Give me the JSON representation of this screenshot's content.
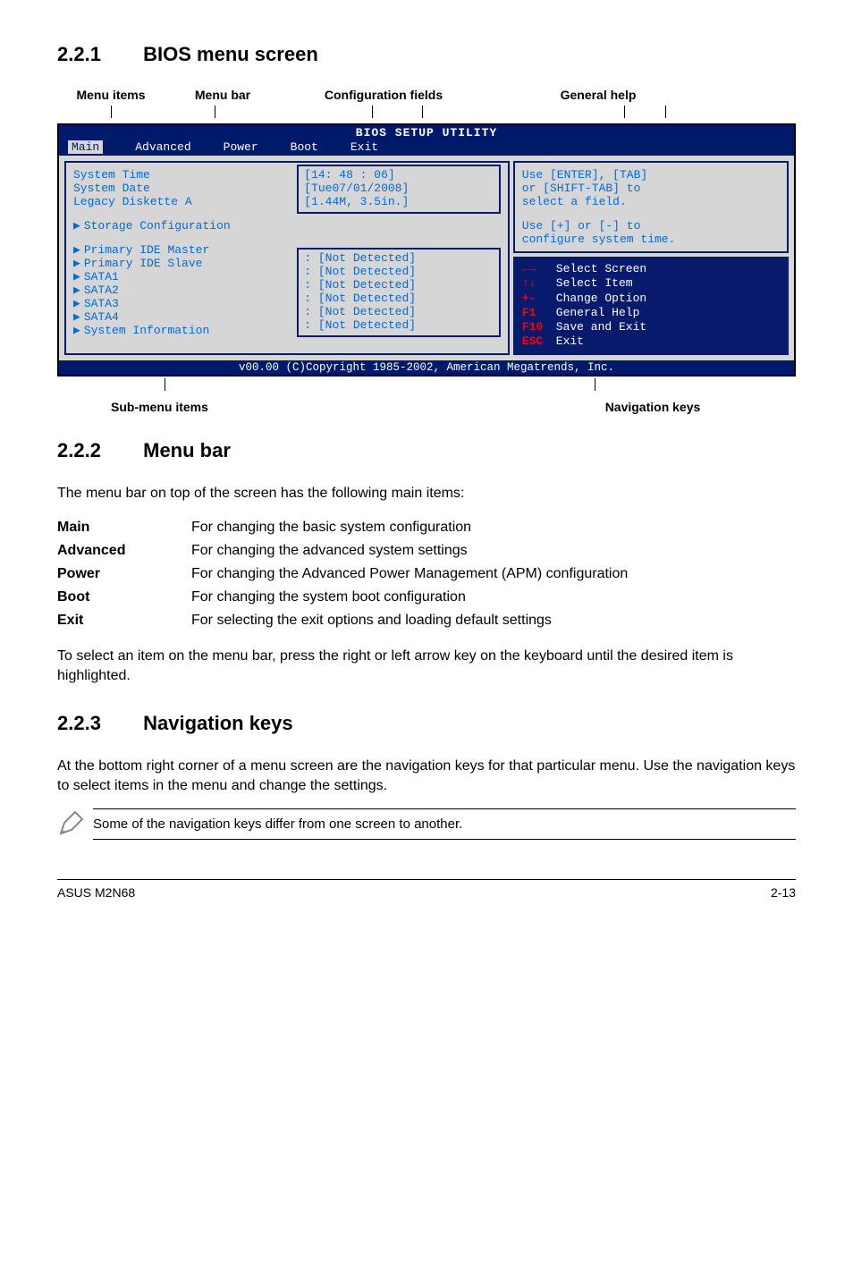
{
  "sections": {
    "s1": {
      "num": "2.2.1",
      "title": "BIOS menu screen"
    },
    "s2": {
      "num": "2.2.2",
      "title": "Menu bar"
    },
    "s3": {
      "num": "2.2.3",
      "title": "Navigation keys"
    }
  },
  "diagram_labels": {
    "menu_items": "Menu items",
    "menu_bar": "Menu bar",
    "config_fields": "Configuration fields",
    "general_help": "General help",
    "sub_menu": "Sub-menu items",
    "nav_keys": "Navigation keys"
  },
  "bios": {
    "title": "BIOS SETUP UTILITY",
    "tabs": {
      "main": "Main",
      "advanced": "Advanced",
      "power": "Power",
      "boot": "Boot",
      "exit": "Exit"
    },
    "fields": {
      "system_time": {
        "label": "System Time",
        "value": "[14: 48 : 06]"
      },
      "system_date": {
        "label": "System Date",
        "value": "[Tue07/01/2008]"
      },
      "legacy_diskette": {
        "label": "Legacy Diskette A",
        "value": "[1.44M, 3.5in.]"
      },
      "storage_config": {
        "label": "Storage Configuration"
      },
      "pri_master": {
        "label": "Primary IDE Master",
        "value": ": [Not Detected]"
      },
      "pri_slave": {
        "label": "Primary IDE Slave",
        "value": ": [Not Detected]"
      },
      "sata1": {
        "label": "SATA1",
        "value": ": [Not Detected]"
      },
      "sata2": {
        "label": "SATA2",
        "value": ": [Not Detected]"
      },
      "sata3": {
        "label": "SATA3",
        "value": ": [Not Detected]"
      },
      "sata4": {
        "label": "SATA4",
        "value": ": [Not Detected]"
      },
      "sys_info": {
        "label": "System Information"
      }
    },
    "help": {
      "l1": "Use [ENTER], [TAB]",
      "l2": "or [SHIFT-TAB] to",
      "l3": "select a field.",
      "l4": "Use [+] or [-] to",
      "l5": "configure system time."
    },
    "nav": {
      "select_screen": "Select Screen",
      "select_item": "Select Item",
      "change_option": "Change Option",
      "general_help": "General Help",
      "save_exit": "Save and Exit",
      "exit": "Exit",
      "k_lr": "←→",
      "k_ud": "↑↓",
      "k_pm": "+-",
      "k_f1": "F1",
      "k_f10": "F10",
      "k_esc": "ESC"
    },
    "footer": "v00.00 (C)Copyright 1985-2002, American Megatrends, Inc."
  },
  "menubar_intro": "The menu bar on top of the screen has the following main items:",
  "defs": {
    "main": {
      "term": "Main",
      "desc": "For changing the basic system configuration"
    },
    "advanced": {
      "term": "Advanced",
      "desc": "For changing the advanced system settings"
    },
    "power": {
      "term": "Power",
      "desc": "For changing the Advanced Power Management (APM) configuration"
    },
    "boot": {
      "term": "Boot",
      "desc": "For changing the system boot configuration"
    },
    "exit": {
      "term": "Exit",
      "desc": "For selecting the exit options and loading default settings"
    }
  },
  "menubar_tail": "To select an item on the menu bar, press the right or left arrow key on the keyboard until the desired item is highlighted.",
  "navkeys_body": "At the bottom right corner of a menu screen are the navigation keys for that particular menu. Use the navigation keys to select items in the menu and change the settings.",
  "note": "Some of the navigation keys differ from one screen to another.",
  "footer": {
    "left": "ASUS M2N68",
    "right": "2-13"
  }
}
